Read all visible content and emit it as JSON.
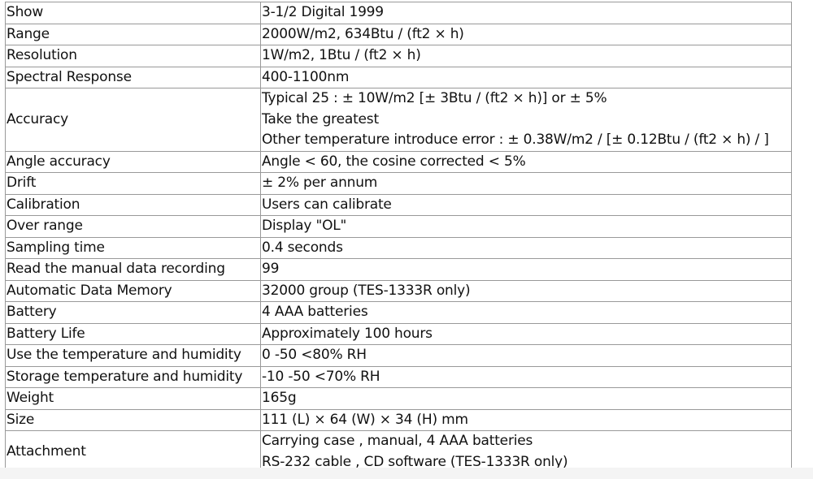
{
  "specs": [
    {
      "label": "Show",
      "value": [
        "3-1/2 Digital 1999"
      ]
    },
    {
      "label": "Range",
      "value": [
        "2000W/m2, 634Btu / (ft2 × h)"
      ]
    },
    {
      "label": "Resolution",
      "value": [
        "1W/m2, 1Btu / (ft2 × h)"
      ]
    },
    {
      "label": "Spectral Response",
      "value": [
        "400-1100nm"
      ]
    },
    {
      "label": "Accuracy",
      "value": [
        "Typical 25 : ± 10W/m2 [± 3Btu / (ft2 × h)] or ± 5%",
        "Take the greatest",
        "Other temperature introduce error : ± 0.38W/m2 / [± 0.12Btu / (ft2 × h) / ]"
      ]
    },
    {
      "label": "Angle accuracy",
      "value": [
        "Angle < 60, the cosine corrected < 5%"
      ]
    },
    {
      "label": "Drift",
      "value": [
        "± 2% per annum"
      ]
    },
    {
      "label": "Calibration",
      "value": [
        "Users can calibrate"
      ]
    },
    {
      "label": "Over range",
      "value": [
        "Display \"OL\""
      ]
    },
    {
      "label": "Sampling time",
      "value": [
        "0.4 seconds"
      ]
    },
    {
      "label": "Read the manual data recording",
      "value": [
        "99"
      ]
    },
    {
      "label": "Automatic Data Memory",
      "value": [
        "32000 group (TES-1333R only)"
      ]
    },
    {
      "label": "Battery",
      "value": [
        "4 AAA batteries"
      ]
    },
    {
      "label": "Battery Life",
      "value": [
        "Approximately 100 hours"
      ]
    },
    {
      "label": "Use the temperature and humidity",
      "value": [
        "0 -50 <80% RH"
      ]
    },
    {
      "label": "Storage temperature and humidity",
      "value": [
        "-10 -50 <70% RH"
      ]
    },
    {
      "label": "Weight",
      "value": [
        "165g"
      ]
    },
    {
      "label": "Size",
      "value": [
        "111 (L) × 64 (W) × 34 (H) mm"
      ]
    },
    {
      "label": "Attachment",
      "value": [
        "Carrying case , manual, 4 AAA batteries",
        "RS-232 cable , CD software (TES-1333R only)"
      ]
    }
  ]
}
